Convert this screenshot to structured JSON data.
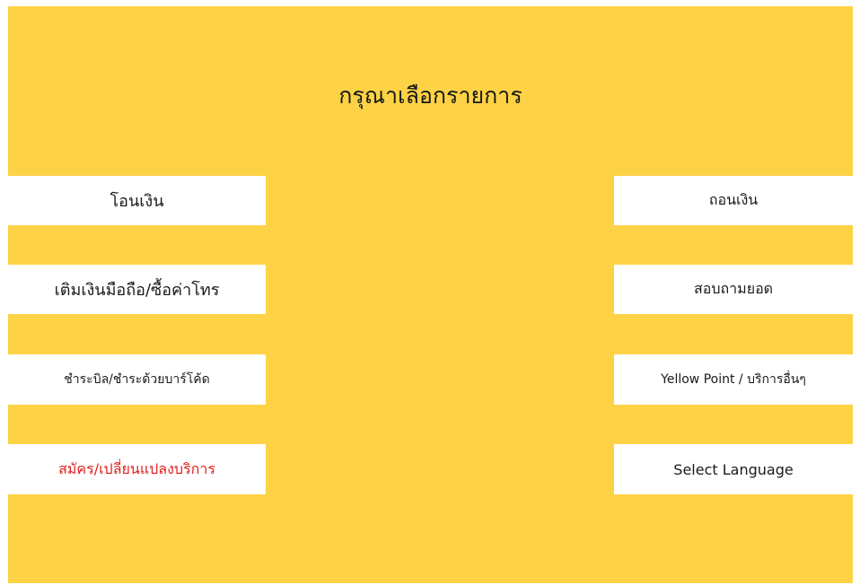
{
  "header": {
    "title": "กรุณาเลือกรายการ"
  },
  "menu": {
    "left": [
      {
        "label": "โอนเงิน"
      },
      {
        "label": "เติมเงินมือถือ/ซื้อค่าโทร"
      },
      {
        "label": "ชำระบิล/ชำระด้วยบาร์โค้ด"
      },
      {
        "label": "สมัคร/เปลี่ยนแปลงบริการ"
      }
    ],
    "right": [
      {
        "label": "ถอนเงิน"
      },
      {
        "label": "สอบถามยอด"
      },
      {
        "label": "Yellow Point / บริการอื่นๆ"
      },
      {
        "label": "Select Language"
      }
    ]
  },
  "colors": {
    "background": "#fdd245",
    "button": "#ffffff",
    "text": "#1a1a1a",
    "highlight_text": "#e0201e"
  }
}
